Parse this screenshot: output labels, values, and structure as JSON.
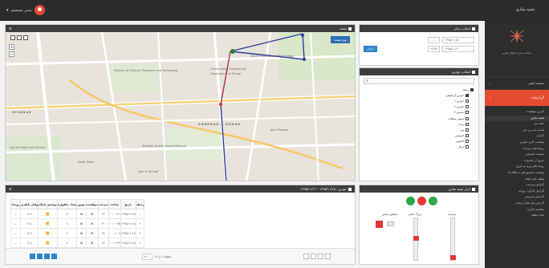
{
  "topbar": {
    "user_label": "مدیر سیستم",
    "brand": "شبیه سازی"
  },
  "sidebar": {
    "logo_text": "سامانه مدیریت ناوگان خودرو",
    "head": "صفحه اصلی",
    "active": "گزارشات",
    "items": [
      "آخرین موقعیت",
      "شبیه سازی",
      "خط سیر",
      "لیست جی پی اس",
      "کارکرد",
      "وضعیت کاری خودرو",
      "رویدادهای سرعت",
      "سوخت مصرفی",
      "خروج از محدوده",
      "رویدادهای ورود و خروج",
      "وضعیت سنسورهای دستگاه ها",
      "توقف های کوتاه",
      "گزارش سرعت",
      "گزارش کارکرد روزانه",
      "گزارش سرویس",
      "گزارش پیام های ارسالی",
      "مقایسه کارکرد",
      "تعداد توقف"
    ]
  },
  "map": {
    "title": "نقشه",
    "type_button": "نوع نقشه",
    "labels": [
      "Sharif University of Technology",
      "Ministry of Science, Research and Technology",
      "Construction Engineering",
      "Department of Tehran",
      "SHAHRAK-E GHARB",
      "Shahrak Gharb Central Mosque",
      "Milad Tower",
      "Jalal Al Ahmad",
      "DIVANAK",
      "Hall of Health and Fitness",
      "Jami Mosque"
    ]
  },
  "date_panel": {
    "title": "انتخاب زمان",
    "from_date": "۱۳۹۵/۱۱/۱۵",
    "from_time": "۰۰:۰۰",
    "to_date": "۱۳۹۵/۱۱/۱۶",
    "to_time": "۲۳:۵۹",
    "apply": "اعمال"
  },
  "vehicle_panel": {
    "title": "انتخاب خودرو",
    "search_placeholder": "",
    "root": "ریشه",
    "items": [
      "خودرو آزمایشی",
      "خودرو ۱",
      "خودرو ۲",
      "ماشین ۳",
      "موتور سیکلت",
      "پراید",
      "ون",
      "اتوبوس",
      "کامیون",
      "تریلر"
    ]
  },
  "table_panel": {
    "title": "خودرو : ۱۳۹۵/۱۱/۱۵ - ۱۳۹۵/۱۱/۱۶",
    "columns": [
      "ردیف",
      "تاریخ",
      "ساعت",
      "سرعت",
      "موقعیت",
      "موتور",
      "تعداد ماهواره",
      "پوشش شبکه",
      "ولتاژ باطری",
      "رویداد"
    ],
    "rows": [
      [
        "۱",
        "۱۳۹۵/۱۱/۱۵",
        "۰۰:۰۰:۲۱",
        "۳۲",
        "",
        "",
        "۷",
        "",
        "۱۲.۸",
        "—"
      ],
      [
        "۲",
        "۱۳۹۵/۱۱/۱۵",
        "۰۰:۰۰:۴۵",
        "۴۱",
        "",
        "",
        "۸",
        "",
        "۱۲.۸",
        "—"
      ],
      [
        "۳",
        "۱۳۹۵/۱۱/۱۵",
        "۰۰:۰۱:۰۹",
        "۳۸",
        "",
        "",
        "۷",
        "",
        "۱۲.۷",
        "—"
      ],
      [
        "۴",
        "۱۳۹۵/۱۱/۱۵",
        "۰۰:۰۱:۳۳",
        "۲۴",
        "",
        "",
        "۸",
        "",
        "۱۲.۸",
        "—"
      ]
    ],
    "page_info": "صفحه ۱ از ۱۲"
  },
  "sim_panel": {
    "title": "ابزار شبیه سازی",
    "speed_label": "سرعت",
    "zoom_label": "بزرگ نمایی",
    "follow_label": "نمایش مسیر"
  }
}
